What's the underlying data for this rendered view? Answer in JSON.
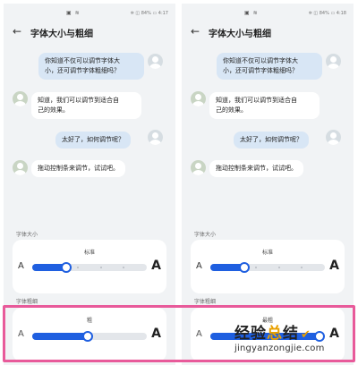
{
  "screens": [
    {
      "status": {
        "icons": "▣ ≋",
        "battery_time": "✲ ◫ 84% ▭ 4:17"
      },
      "title": "字体大小与粗细",
      "messages": [
        {
          "dir": "out",
          "text": "你知道不仅可以调节字体大\n小，还可调节字体粗细吗？"
        },
        {
          "dir": "in",
          "text": "知道，我们可以调节到适合自\n己的效果。"
        },
        {
          "dir": "out",
          "text": "太好了，如何调节呢？"
        },
        {
          "dir": "in",
          "text": "拖动控制条来调节，试试吧。"
        }
      ],
      "size_section_label": "字体大小",
      "size_value": "标准",
      "size_level": 0.28,
      "size_a_small": "A",
      "size_a_large": "A",
      "weight_section_label": "字体粗细",
      "weight_value": "粗",
      "weight_level": 0.48,
      "weight_a_small": "A",
      "weight_a_large": "A"
    },
    {
      "status": {
        "icons": "▣ ≋",
        "battery_time": "✲ ◫ 84% ▭ 4:18"
      },
      "title": "字体大小与粗细",
      "messages": [
        {
          "dir": "out",
          "text": "你知道不仅可以调节字体大\n小，还可调节字体粗细吗？"
        },
        {
          "dir": "in",
          "text": "知道，我们可以调节到适合自\n己的效果。"
        },
        {
          "dir": "out",
          "text": "太好了，如何调节呢？"
        },
        {
          "dir": "in",
          "text": "拖动控制条来调节，试试吧。"
        }
      ],
      "size_section_label": "字体大小",
      "size_value": "标准",
      "size_level": 0.28,
      "size_a_small": "A",
      "size_a_large": "A",
      "weight_section_label": "字体粗细",
      "weight_value": "最粗",
      "weight_level": 1.0,
      "weight_a_small": "A",
      "weight_a_large": "A"
    }
  ],
  "watermark": {
    "text_a": "经验",
    "text_b": "总",
    "text_c": "结",
    "check": "✔",
    "url": "jingyanzongjie.com"
  },
  "colors": {
    "accent": "#1f5fe0",
    "highlight_border": "#e85a9a",
    "bubble_out": "#d8e6f5",
    "watermark_accent": "#e8a000"
  }
}
